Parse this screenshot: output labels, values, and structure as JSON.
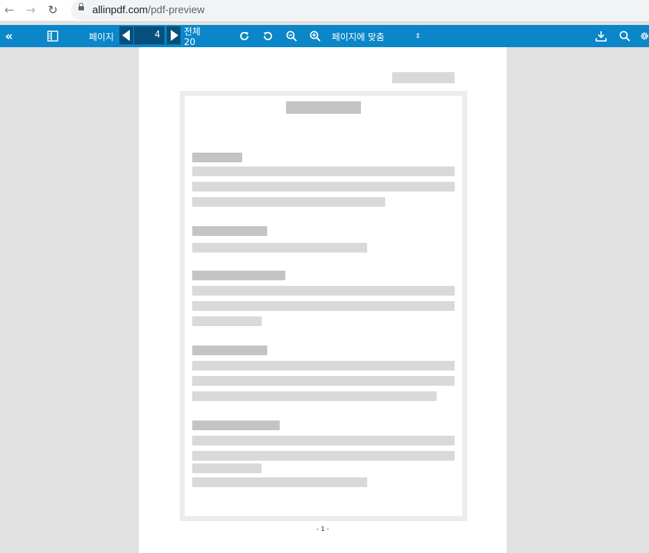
{
  "browser": {
    "url_host": "allinpdf.com",
    "url_path": "/pdf-preview"
  },
  "toolbar": {
    "page_label": "페이지",
    "current_page": "4",
    "total_label": "전체 20",
    "zoom_option": "페이지에 맞춤"
  },
  "document": {
    "page_footer": "- 1 -"
  }
}
